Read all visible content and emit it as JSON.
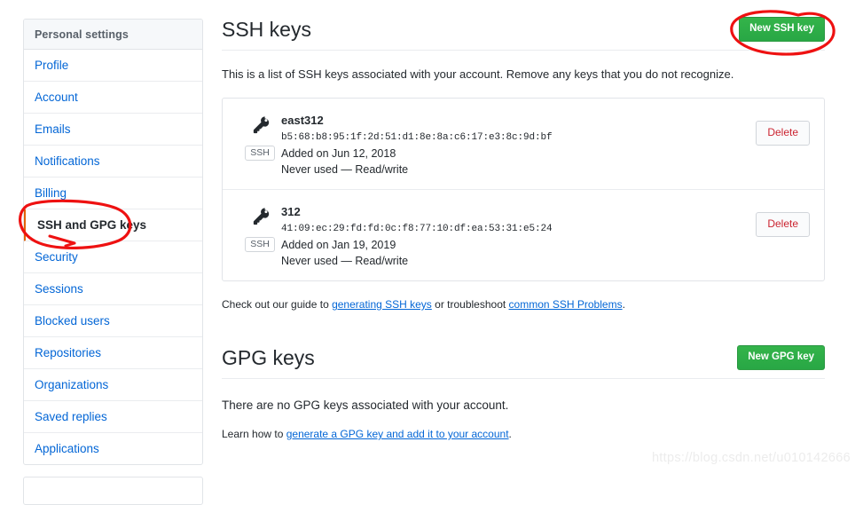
{
  "sidebar": {
    "header": "Personal settings",
    "items": [
      {
        "label": "Profile",
        "active": false
      },
      {
        "label": "Account",
        "active": false
      },
      {
        "label": "Emails",
        "active": false
      },
      {
        "label": "Notifications",
        "active": false
      },
      {
        "label": "Billing",
        "active": false
      },
      {
        "label": "SSH and GPG keys",
        "active": true
      },
      {
        "label": "Security",
        "active": false
      },
      {
        "label": "Sessions",
        "active": false
      },
      {
        "label": "Blocked users",
        "active": false
      },
      {
        "label": "Repositories",
        "active": false
      },
      {
        "label": "Organizations",
        "active": false
      },
      {
        "label": "Saved replies",
        "active": false
      },
      {
        "label": "Applications",
        "active": false
      }
    ]
  },
  "ssh": {
    "title": "SSH keys",
    "new_button": "New SSH key",
    "intro": "This is a list of SSH keys associated with your account. Remove any keys that you do not recognize.",
    "delete_label": "Delete",
    "badge": "SSH",
    "keys": [
      {
        "name": "east312",
        "fingerprint": "b5:68:b8:95:1f:2d:51:d1:8e:8a:c6:17:e3:8c:9d:bf",
        "added": "Added on Jun 12, 2018",
        "usage": "Never used — Read/write"
      },
      {
        "name": "312",
        "fingerprint": "41:09:ec:29:fd:fd:0c:f8:77:10:df:ea:53:31:e5:24",
        "added": "Added on Jan 19, 2019",
        "usage": "Never used — Read/write"
      }
    ],
    "guide": {
      "prefix": "Check out our guide to ",
      "link1": "generating SSH keys",
      "middle": " or troubleshoot ",
      "link2": "common SSH Problems",
      "suffix": "."
    }
  },
  "gpg": {
    "title": "GPG keys",
    "new_button": "New GPG key",
    "empty": "There are no GPG keys associated with your account.",
    "learn": {
      "prefix": "Learn how to ",
      "link": "generate a GPG key and add it to your account",
      "suffix": "."
    }
  },
  "annotations": {
    "color": "#ee1111",
    "circle_sidebar": "red-ellipse-around-ssh-and-gpg-keys",
    "circle_button": "red-ellipse-around-new-ssh-key-button"
  },
  "watermark": "https://blog.csdn.net/u010142666"
}
